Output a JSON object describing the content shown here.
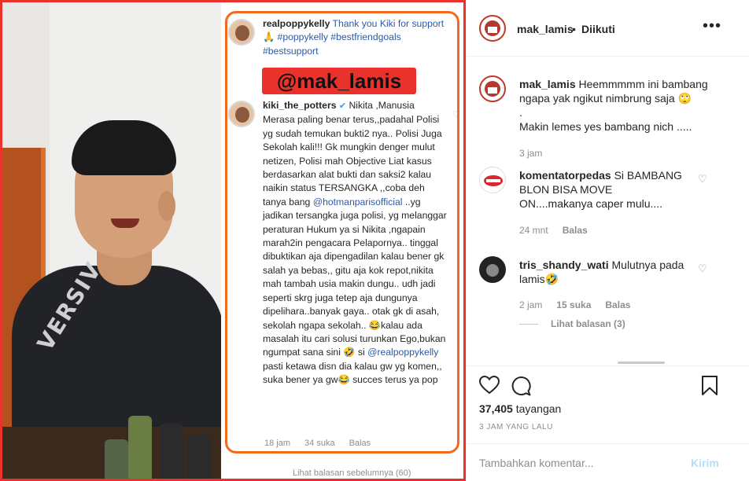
{
  "post": {
    "username": "mak_lamis",
    "separator": "•",
    "follow_status": "Diikuti",
    "more_label": "•••"
  },
  "media": {
    "hoodie_text": "VERSIV",
    "watermark": "@mak_lamis",
    "screenshot": {
      "caption_user": "realpoppykelly",
      "caption_text": " Thank you Kiki for support 🙏 #poppykelly #bestfriendgoals #bestsupport",
      "comment_user": "kiki_the_potters",
      "comment_verified": "✔",
      "comment_text_1": " Nikita ,Manusia Merasa paling benar terus,,padahal Polisi yg sudah temukan bukti2 nya.. Polisi Juga Sekolah kali!!! Gk mungkin denger mulut netizen, Polisi mah Objective Liat kasus berdasarkan alat bukti dan saksi2 kalau naikin status TERSANGKA ,,coba deh tanya bang ",
      "mention_1": "@hotmanparisofficial",
      "comment_text_2": " ..yg jadikan tersangka juga polisi, yg melanggar peraturan Hukum ya si Nikita ,ngapain marah2in pengacara Pelapornya.. tinggal dibuktikan aja dipengadilan kalau bener gk salah ya bebas,, gitu aja kok repot,nikita mah tambah usia makin dungu.. udh jadi seperti skrg juga tetep aja dungunya dipelihara..banyak gaya.. otak gk di asah, sekolah ngapa sekolah.. 😂kalau ada masalah itu cari solusi turunkan Ego,bukan ngumpat sana sini 🤣 si ",
      "mention_2": "@realpoppykelly",
      "comment_text_3": " pasti ketawa disn dia kalau gw yg komen,, suka bener ya gw😂 succes terus ya pop",
      "meta_time": "18 jam",
      "meta_likes": "34 suka",
      "meta_reply": "Balas",
      "more_replies": "Lihat balasan sebelumnya (60)",
      "heart": "♡"
    }
  },
  "comments": [
    {
      "username": "mak_lamis",
      "text_line1": " Heemmmmm ini bambang ngapa yak ngikut nimbrung saja 🙄",
      "text_line2": ".",
      "text_line3": "Makin lemes yes bambang nich .....",
      "time": "3 jam"
    },
    {
      "username": "komentatorpedas",
      "text": " Si BAMBANG BLON BISA MOVE ON....makanya caper mulu....",
      "time": "24 mnt",
      "reply": "Balas",
      "heart": "♡"
    },
    {
      "username": "tris_shandy_wati",
      "text": " Mulutnya pada lamis🤣",
      "time": "2 jam",
      "likes": "15 suka",
      "reply": "Balas",
      "view_replies": "Lihat balasan (3)",
      "heart": "♡"
    }
  ],
  "actions": {
    "like_icon": "heart-icon",
    "comment_icon": "comment-icon",
    "save_icon": "bookmark-icon",
    "views_count": "37,405",
    "views_label": " tayangan",
    "date": "3 JAM YANG LALU"
  },
  "add_comment": {
    "placeholder": "Tambahkan komentar...",
    "submit_label": "Kirim"
  },
  "colors": {
    "frame_red": "#e8322b",
    "frame_orange": "#f26a21",
    "link_blue": "#2b5aa8",
    "submit_disabled": "#b2dffc",
    "muted": "#8e8e8e"
  }
}
